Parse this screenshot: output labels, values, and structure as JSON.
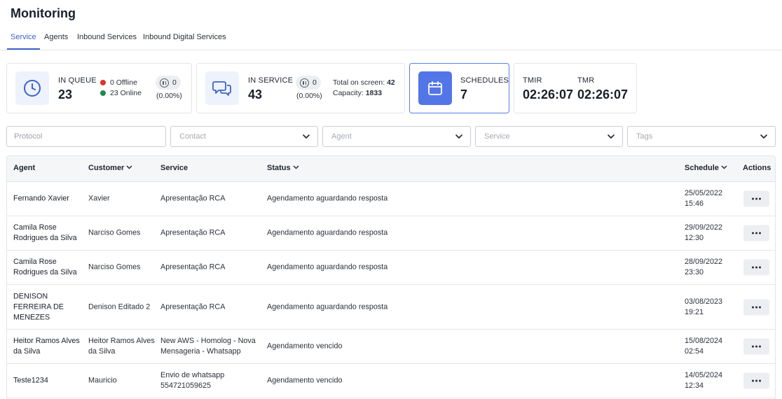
{
  "page": {
    "title": "Monitoring"
  },
  "tabs": [
    {
      "label": "Service",
      "active": true
    },
    {
      "label": "Agents"
    },
    {
      "label": "Inbound Services"
    },
    {
      "label": "Inbound Digital Services"
    }
  ],
  "cards": {
    "in_queue": {
      "label": "IN QUEUE",
      "value": "23",
      "offline": "0 Offline",
      "online": "23 Online",
      "paused": "0",
      "paused_pct": "(0.00%)",
      "offline_color": "#e0322f",
      "online_color": "#1e8a52"
    },
    "in_service": {
      "label": "IN SERVICE",
      "value": "43",
      "paused": "0",
      "paused_pct": "(0.00%)",
      "total_label": "Total on screen:",
      "total_value": "42",
      "capacity_label": "Capacity:",
      "capacity_value": "1833"
    },
    "schedules": {
      "label": "SCHEDULES",
      "value": "7",
      "accent": "#5276e8"
    },
    "times": {
      "tmir_label": "TMIR",
      "tmir_value": "02:26:07",
      "tmr_label": "TMR",
      "tmr_value": "02:26:07"
    }
  },
  "filters": {
    "protocol_placeholder": "Protocol",
    "contact_placeholder": "Contact",
    "agent_placeholder": "Agent",
    "service_placeholder": "Service",
    "tags_placeholder": "Tags"
  },
  "table": {
    "headers": {
      "agent": "Agent",
      "customer": "Customer",
      "service": "Service",
      "status": "Status",
      "schedule": "Schedule",
      "actions": "Actions"
    },
    "rows": [
      {
        "agent": "Fernando Xavier",
        "customer": "Xavier",
        "service": "Apresentação RCA",
        "status": "Agendamento aguardando resposta",
        "date": "25/05/2022",
        "time": "15:46"
      },
      {
        "agent": "Camila Rose Rodrigues da Silva",
        "customer": "Narciso Gomes",
        "service": "Apresentação RCA",
        "status": "Agendamento aguardando resposta",
        "date": "29/09/2022",
        "time": "12:30"
      },
      {
        "agent": "Camila Rose Rodrigues da Silva",
        "customer": "Narciso Gomes",
        "service": "Apresentação RCA",
        "status": "Agendamento aguardando resposta",
        "date": "28/09/2022",
        "time": "23:30"
      },
      {
        "agent": "DENISON FERREIRA DE MENEZES",
        "customer": "Denison Editado 2",
        "service": "Apresentação RCA",
        "status": "Agendamento aguardando resposta",
        "date": "03/08/2023",
        "time": "19:21"
      },
      {
        "agent": "Heitor Ramos Alves da Silva",
        "customer": "Heitor Ramos Alves da Silva",
        "service": "New AWS - Homolog - Nova Mensageria - Whatsapp",
        "status": "Agendamento vencido",
        "date": "15/08/2024",
        "time": "02:54"
      },
      {
        "agent": "Teste1234",
        "customer": "Mauricio",
        "service": "Envio de whatsapp 554721059625",
        "status": "Agendamento vencido",
        "date": "14/05/2024",
        "time": "12:34"
      }
    ]
  }
}
